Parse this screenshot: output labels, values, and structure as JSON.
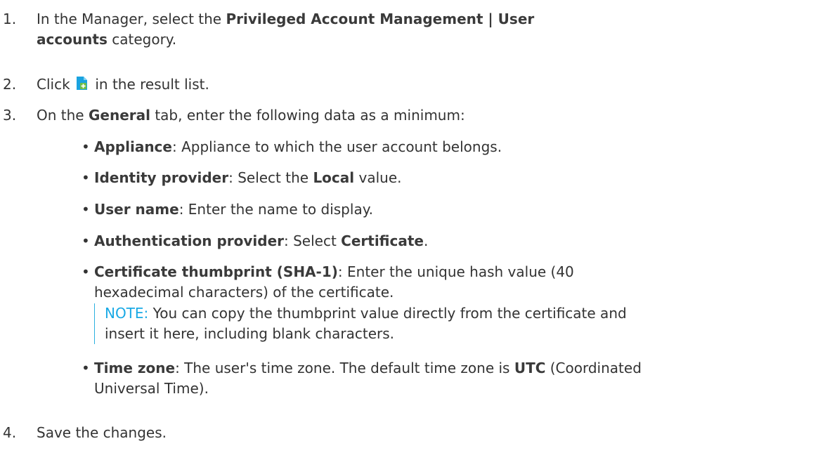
{
  "steps": [
    {
      "number": "1.",
      "pre": "In the Manager, select the ",
      "bold1": "Privileged Account Management | User",
      "bold2": "accounts",
      "post": " category."
    },
    {
      "number": "2.",
      "pre": "Click ",
      "icon": "new-document-icon",
      "post": " in the result list."
    },
    {
      "number": "3.",
      "pre": "On the ",
      "bold": "General",
      "post": " tab, enter the following data as a minimum:"
    },
    {
      "number": "4.",
      "text": "Save the changes."
    }
  ],
  "bullets": {
    "appliance": {
      "label": "Appliance",
      "text": ": Appliance to which the user account belongs."
    },
    "identity_provider": {
      "label": "Identity provider",
      "pre": ": Select the ",
      "bold": "Local",
      "post": " value."
    },
    "user_name": {
      "label": "User name",
      "text": ": Enter the name to display."
    },
    "authentication_provider": {
      "label": "Authentication provider",
      "pre": ": Select ",
      "bold": "Certificate",
      "post": "."
    },
    "certificate_thumbprint": {
      "label": "Certificate thumbprint (SHA-1)",
      "line1": ": Enter the unique hash value (40",
      "line2": "hexadecimal characters) of the certificate."
    },
    "time_zone": {
      "label": "Time zone",
      "pre": ": The user's time zone. The default time zone is ",
      "bold": "UTC",
      "post1": " (Coordinated",
      "post2": "Universal Time)."
    }
  },
  "note": {
    "label": "NOTE:",
    "line1": " You can copy the thumbprint value directly from the certificate and",
    "line2": "insert it here, including blank characters."
  },
  "colors": {
    "text": "#333333",
    "note_accent": "#19a9e5",
    "icon_blue": "#1aa3e0",
    "icon_green": "#6fbe44"
  }
}
